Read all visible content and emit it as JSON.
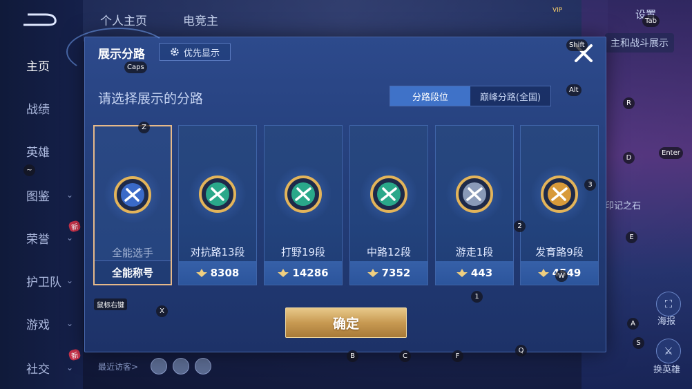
{
  "sidebar": {
    "items": [
      {
        "label": "主页",
        "active": true
      },
      {
        "label": "战绩"
      },
      {
        "label": "英雄"
      },
      {
        "label": "图鉴"
      },
      {
        "label": "荣誉",
        "badge": "新"
      },
      {
        "label": "护卫队"
      },
      {
        "label": "游戏"
      },
      {
        "label": "社交",
        "badge": "新"
      }
    ]
  },
  "topnav": {
    "tabs": [
      "个人主页",
      "电竞主"
    ]
  },
  "top_right": {
    "vip": "VIP",
    "settings": "设置"
  },
  "right_panel": {
    "banner": "主和战斗展示",
    "label_mid": "印记之石",
    "btn_report": "海报",
    "btn_swap": "换英雄"
  },
  "recent_visitors": "最近访客>",
  "modal": {
    "title": "展示分路",
    "priority_btn": "优先显示",
    "subtitle": "请选择展示的分路",
    "tabs": [
      {
        "label": "分路段位",
        "active": true
      },
      {
        "label": "巅峰分路(全国)",
        "active": false
      }
    ],
    "cards": [
      {
        "name": "全能选手",
        "foot": "全能称号",
        "selected": true,
        "badge": "all-round-badge-icon",
        "color": "#3a6ac8"
      },
      {
        "name": "对抗路13段",
        "foot": "8308",
        "badge": "clash-lane-badge-icon",
        "color": "#2aa88a"
      },
      {
        "name": "打野19段",
        "foot": "14286",
        "badge": "jungle-badge-icon",
        "color": "#2aa88a"
      },
      {
        "name": "中路12段",
        "foot": "7352",
        "badge": "mid-lane-badge-icon",
        "color": "#2aa88a"
      },
      {
        "name": "游走1段",
        "foot": "443",
        "badge": "roam-badge-icon",
        "color": "#8a9ab8"
      },
      {
        "name": "发育路9段",
        "foot": "4549",
        "badge": "farm-lane-badge-icon",
        "color": "#d89a3a"
      }
    ],
    "confirm": "确定"
  },
  "key_hints": {
    "tab": "Tab",
    "shift": "Shift",
    "caps": "Caps",
    "alt": "Alt",
    "r": "R",
    "enter": "Enter",
    "d": "D",
    "three": "3",
    "two": "2",
    "e": "E",
    "z": "Z",
    "tilde": "~",
    "w": "W",
    "rmb": "鼠标右键",
    "x": "X",
    "one": "1",
    "a": "A",
    "s": "S",
    "b": "B",
    "c": "C",
    "f": "F",
    "q": "Q"
  }
}
